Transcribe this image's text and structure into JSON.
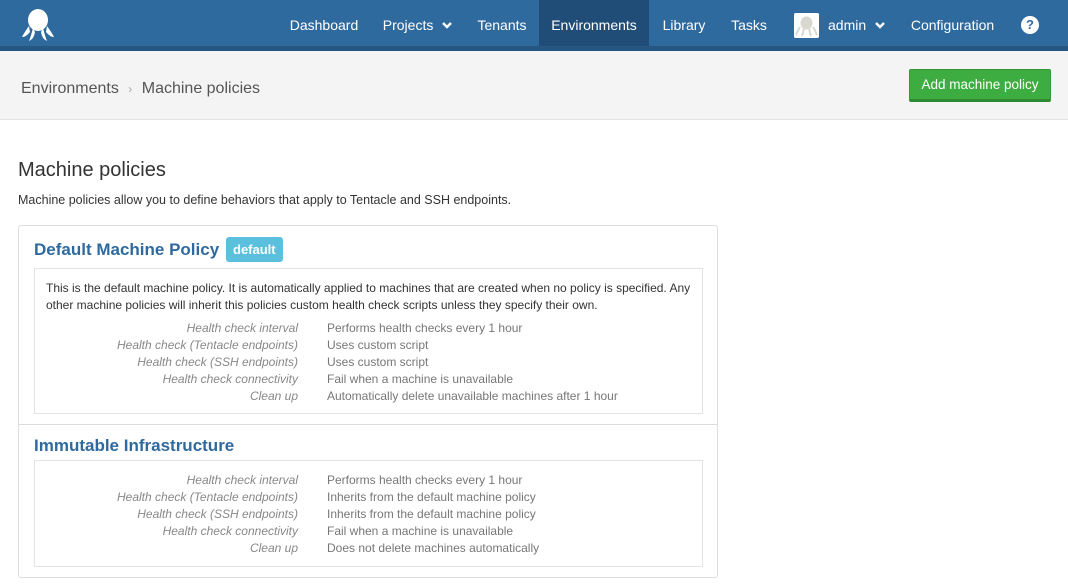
{
  "nav": {
    "items": [
      {
        "label": "Dashboard"
      },
      {
        "label": "Projects"
      },
      {
        "label": "Tenants"
      },
      {
        "label": "Environments"
      },
      {
        "label": "Library"
      },
      {
        "label": "Tasks"
      },
      {
        "label": "admin"
      },
      {
        "label": "Configuration"
      }
    ],
    "active": "Environments",
    "help": "?"
  },
  "breadcrumb": {
    "parent": "Environments",
    "separator": "›",
    "current": "Machine policies"
  },
  "actions": {
    "add_label": "Add machine policy"
  },
  "page": {
    "title": "Machine policies",
    "description": "Machine policies allow you to define behaviors that apply to Tentacle and SSH endpoints."
  },
  "policies": [
    {
      "name": "Default Machine Policy",
      "badge": "default",
      "description": "This is the default machine policy. It is automatically applied to machines that are created when no policy is specified. Any other machine policies will inherit this policies custom health check scripts unless they specify their own.",
      "properties": [
        {
          "label": "Health check interval",
          "value": "Performs health checks every 1 hour"
        },
        {
          "label": "Health check (Tentacle endpoints)",
          "value": "Uses custom script"
        },
        {
          "label": "Health check (SSH endpoints)",
          "value": "Uses custom script"
        },
        {
          "label": "Health check connectivity",
          "value": "Fail when a machine is unavailable"
        },
        {
          "label": "Clean up",
          "value": "Automatically delete unavailable machines after 1 hour"
        }
      ]
    },
    {
      "name": "Immutable Infrastructure",
      "properties": [
        {
          "label": "Health check interval",
          "value": "Performs health checks every 1 hour"
        },
        {
          "label": "Health check (Tentacle endpoints)",
          "value": "Inherits from the default machine policy"
        },
        {
          "label": "Health check (SSH endpoints)",
          "value": "Inherits from the default machine policy"
        },
        {
          "label": "Health check connectivity",
          "value": "Fail when a machine is unavailable"
        },
        {
          "label": "Clean up",
          "value": "Does not delete machines automatically"
        }
      ]
    }
  ],
  "colors": {
    "nav_bg": "#2f6a9f",
    "nav_active": "#1f4d77",
    "link": "#2f6a9f",
    "primary_button": "#3dac41",
    "badge": "#5bc0de"
  }
}
